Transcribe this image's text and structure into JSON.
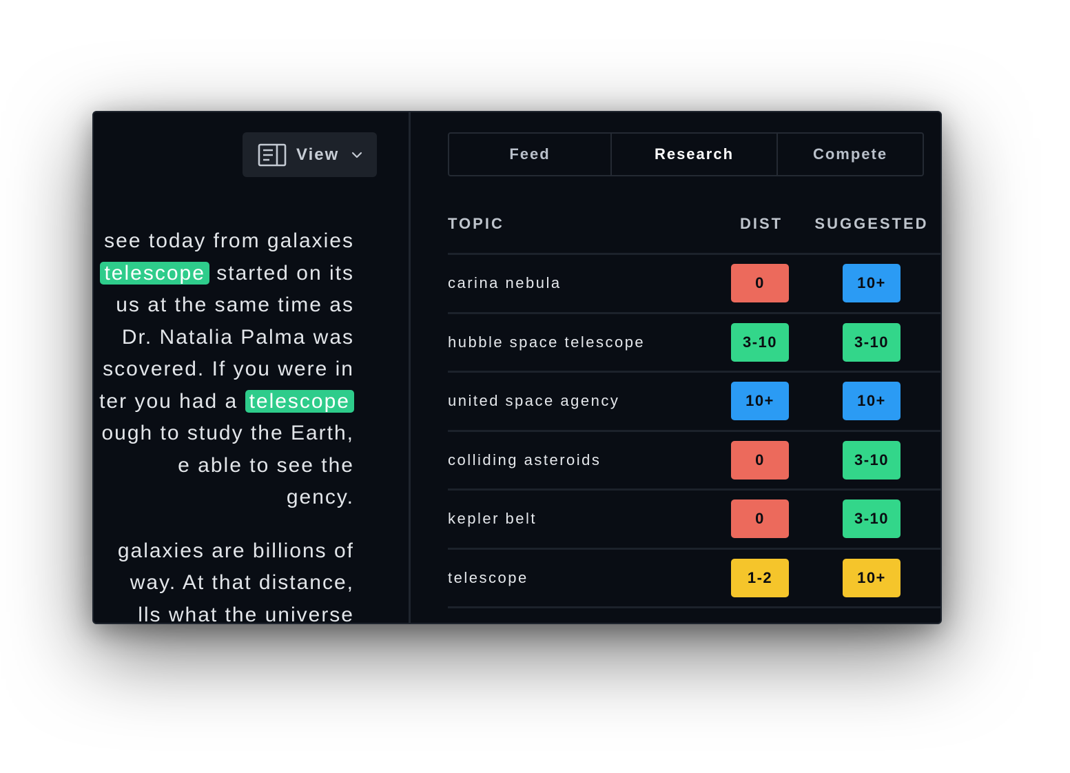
{
  "toolbar": {
    "view_label": "View",
    "view_icon": "document-layout-icon",
    "chevron_icon": "chevron-down-icon"
  },
  "editor": {
    "lines": [
      "see today from galaxies",
      [
        "telescope",
        " started on its"
      ],
      "us at the same time as",
      "Dr. Natalia Palma was",
      "scovered. If you were in",
      [
        "ter you had a ",
        "telescope"
      ],
      "ough to study the Earth,",
      "e able to see the",
      "gency.",
      "",
      "galaxies are billions of",
      "way. At that distance,",
      "lls what the universe"
    ],
    "highlight_color": "#2ecc8b"
  },
  "tabs": [
    {
      "label": "Feed",
      "active": false
    },
    {
      "label": "Research",
      "active": true
    },
    {
      "label": "Compete",
      "active": false
    }
  ],
  "table": {
    "headers": {
      "topic": "TOPIC",
      "dist": "DIST",
      "suggested": "SUGGESTED"
    },
    "rows": [
      {
        "topic": "carina nebula",
        "dist": "0",
        "dist_color": "red",
        "suggested": "10+",
        "suggested_color": "blue"
      },
      {
        "topic": "hubble space telescope",
        "dist": "3-10",
        "dist_color": "green",
        "suggested": "3-10",
        "suggested_color": "green"
      },
      {
        "topic": "united space agency",
        "dist": "10+",
        "dist_color": "blue",
        "suggested": "10+",
        "suggested_color": "blue"
      },
      {
        "topic": "colliding asteroids",
        "dist": "0",
        "dist_color": "red",
        "suggested": "3-10",
        "suggested_color": "green"
      },
      {
        "topic": "kepler belt",
        "dist": "0",
        "dist_color": "red",
        "suggested": "3-10",
        "suggested_color": "green"
      },
      {
        "topic": "telescope",
        "dist": "1-2",
        "dist_color": "yellow",
        "suggested": "10+",
        "suggested_color": "yellow"
      }
    ]
  },
  "colors": {
    "red": "#ec6a5c",
    "green": "#33d68a",
    "blue": "#2b9bf4",
    "yellow": "#f5c52b",
    "background": "#090d14"
  }
}
